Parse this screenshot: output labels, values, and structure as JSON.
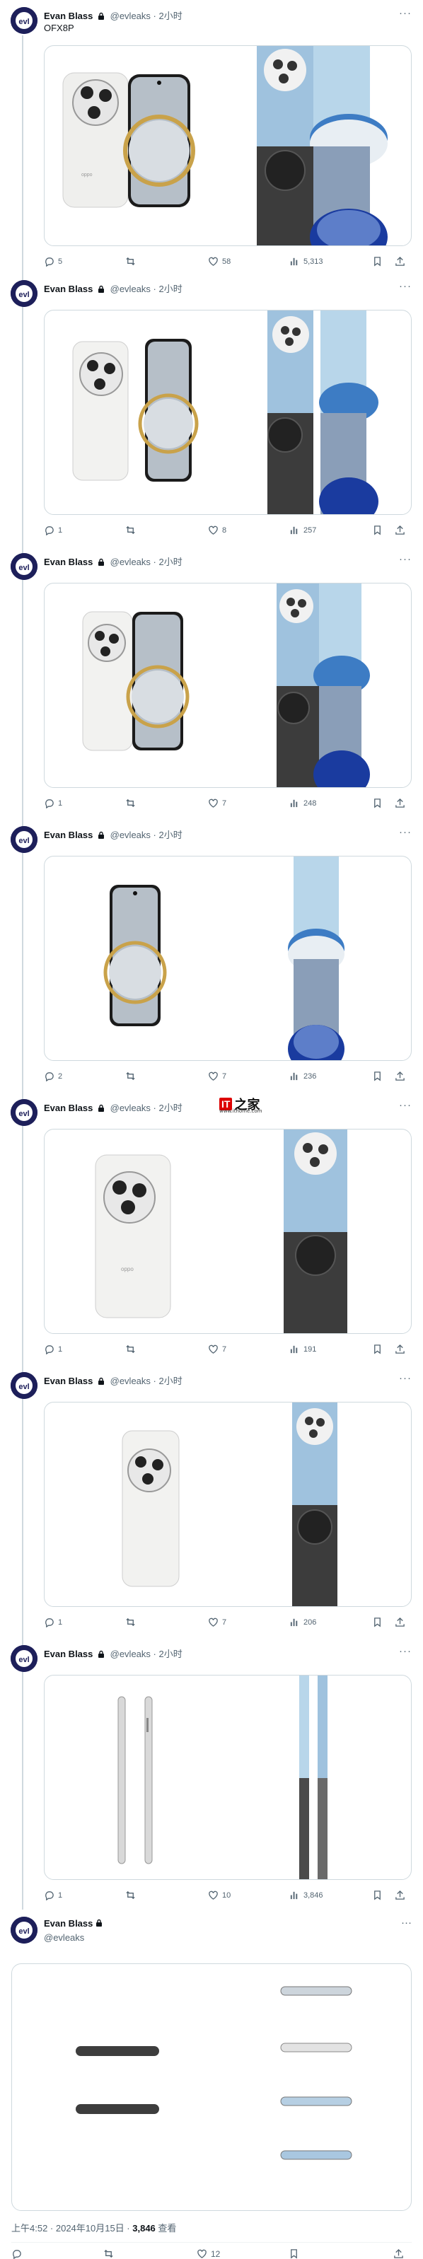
{
  "author": {
    "name": "Evan Blass",
    "handle": "@evleaks",
    "dot": "·",
    "relative_time": "2小时"
  },
  "tweets": [
    {
      "text": "OFX8P",
      "replies": "5",
      "likes": "58",
      "views": "5,313"
    },
    {
      "text": "",
      "replies": "1",
      "likes": "8",
      "views": "257"
    },
    {
      "text": "",
      "replies": "1",
      "likes": "7",
      "views": "248"
    },
    {
      "text": "",
      "replies": "2",
      "likes": "7",
      "views": "236"
    },
    {
      "text": "",
      "replies": "1",
      "likes": "7",
      "views": "191"
    },
    {
      "text": "",
      "replies": "1",
      "likes": "7",
      "views": "206"
    },
    {
      "text": "",
      "replies": "1",
      "likes": "10",
      "views": "3,846"
    }
  ],
  "watermark": {
    "brand": "IT",
    "char": "之家",
    "url": "www.ithome.com"
  },
  "main": {
    "name": "Evan Blass",
    "handle": "@evleaks",
    "timestamp": "上午4:52 · 2024年10月15日 · ",
    "views_count": "3,846",
    "views_label": " 查看",
    "likes": "12"
  },
  "colors": {
    "accent": "#1d9bf0",
    "avatar_bg": "#1d1f5a",
    "phone_white": "#f2f2f0",
    "screen_blue": "#a7cbe6",
    "gold_ring": "#c9a24a",
    "dark_back": "#3a3a3a"
  },
  "icons": [
    "reply-icon",
    "retweet-icon",
    "like-icon",
    "views-icon",
    "bookmark-icon",
    "share-icon",
    "lock-icon",
    "more-icon"
  ]
}
